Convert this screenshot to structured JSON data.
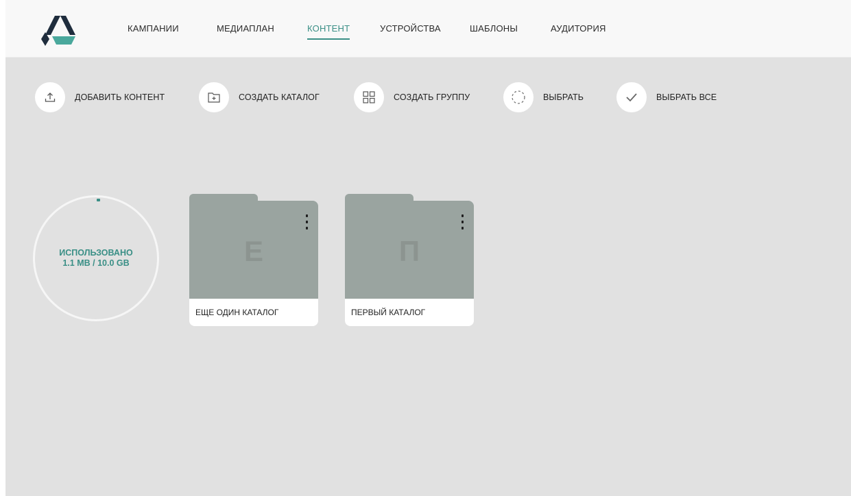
{
  "nav": {
    "items": [
      {
        "label": "КАМПАНИИ"
      },
      {
        "label": "МЕДИАПЛАН"
      },
      {
        "label": "КОНТЕНТ",
        "active": true
      },
      {
        "label": "УСТРОЙСТВА"
      },
      {
        "label": "ШАБЛОНЫ"
      },
      {
        "label": "АУДИТОРИЯ"
      }
    ]
  },
  "actions": {
    "add_content": "ДОБАВИТЬ КОНТЕНТ",
    "create_catalog": "СОЗДАТЬ КАТАЛОГ",
    "create_group": "СОЗДАТЬ ГРУППУ",
    "select": "ВЫБРАТЬ",
    "select_all": "ВЫБРАТЬ ВСЕ"
  },
  "storage": {
    "label": "ИСПОЛЬЗОВАНО",
    "usage": "1.1 MB / 10.0 GB"
  },
  "folders": [
    {
      "letter": "Е",
      "name": "ЕЩЕ ОДИН КАТАЛОГ"
    },
    {
      "letter": "П",
      "name": "ПЕРВЫЙ КАТАЛОГ"
    }
  ],
  "colors": {
    "accent": "#3a8f86",
    "background": "#e1e1e1",
    "folder": "#9aa4a0",
    "logo_dark": "#1f2d3d",
    "logo_teal": "#4aa89c"
  },
  "icons": {
    "logo": "logo-icon",
    "add_content": "upload-icon",
    "create_catalog": "folder-plus-icon",
    "create_group": "grid-icon",
    "select": "dashed-circle-icon",
    "select_all": "checkmark-icon"
  }
}
